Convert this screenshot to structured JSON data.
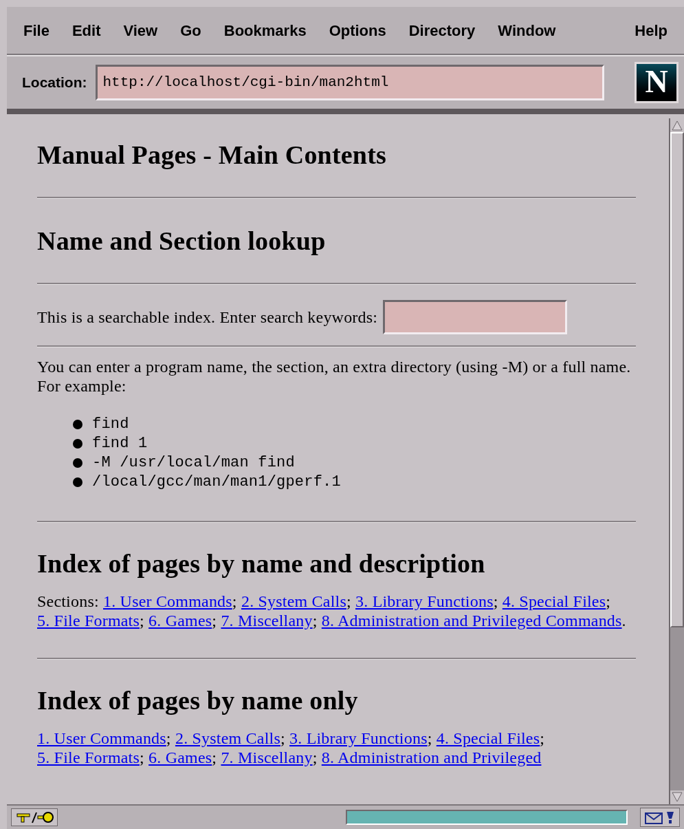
{
  "menu": [
    "File",
    "Edit",
    "View",
    "Go",
    "Bookmarks",
    "Options",
    "Directory",
    "Window",
    "Help"
  ],
  "location": {
    "label": "Location:",
    "value": "http://localhost/cgi-bin/man2html"
  },
  "logo_text": "N",
  "page": {
    "title": "Manual Pages - Main Contents",
    "lookup_heading": "Name and Section lookup",
    "search_prompt": "This is a searchable index. Enter search keywords:",
    "help_text": "You can enter a program name, the section, an extra directory (using -M) or a full name. For example:",
    "examples": [
      "find",
      "find 1",
      "-M /usr/local/man find",
      "/local/gcc/man/man1/gperf.1"
    ],
    "desc_heading": "Index of pages by name and description",
    "sections_label": "Sections:",
    "desc_links": [
      {
        "text": "1. User Commands",
        "after": ";"
      },
      {
        "text": "2. System Calls",
        "after": ";"
      },
      {
        "text": "3. Library Functions",
        "after": ";"
      },
      {
        "text": "4. Special Files",
        "after": ";"
      },
      {
        "text": "5. File Formats",
        "after": ";"
      },
      {
        "text": "6. Games",
        "after": ";"
      },
      {
        "text": "7. Miscellany",
        "after": ";"
      },
      {
        "text": "8. Administration and Privileged Commands",
        "after": "."
      }
    ],
    "name_heading": "Index of pages by name only",
    "name_links": [
      {
        "text": "1. User Commands",
        "after": ";"
      },
      {
        "text": "2. System Calls",
        "after": ";"
      },
      {
        "text": "3. Library Functions",
        "after": ";"
      },
      {
        "text": "4. Special Files",
        "after": ";"
      },
      {
        "text": "5. File Formats",
        "after": ";"
      },
      {
        "text": "6. Games",
        "after": ";"
      },
      {
        "text": "7. Miscellany",
        "after": ";"
      },
      {
        "text": "8. Administration and Privileged"
      }
    ]
  },
  "status": {
    "progress": {
      "level": 1
    }
  }
}
